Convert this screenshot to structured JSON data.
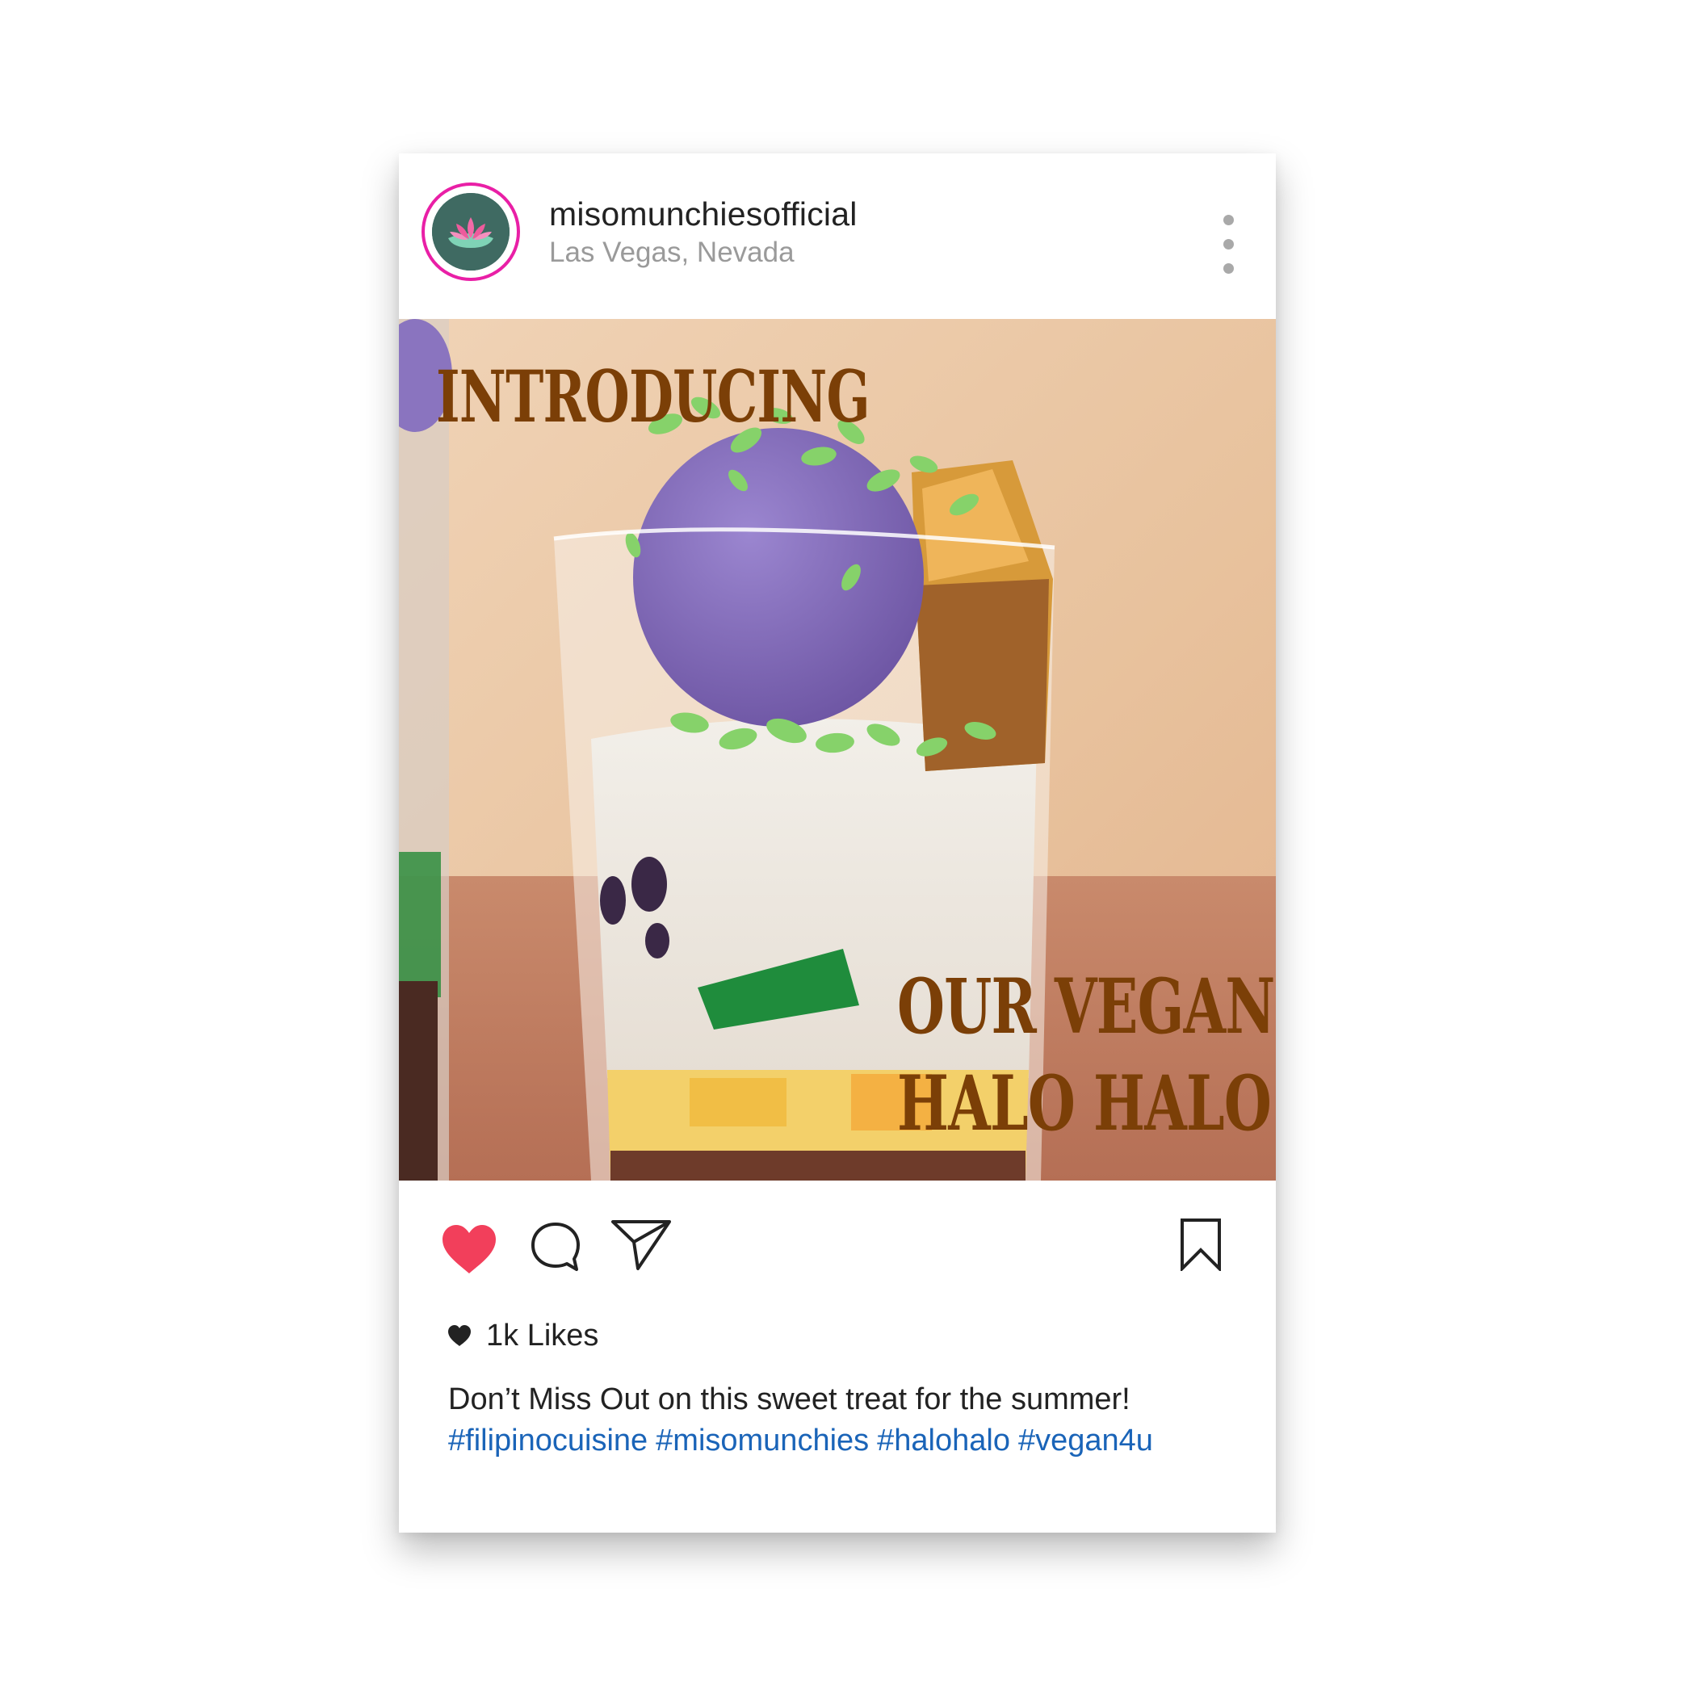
{
  "post": {
    "username": "misomunchiesofficial",
    "location": "Las Vegas, Nevada",
    "image": {
      "line1": "INTRODUCING",
      "line2": "OUR VEGAN",
      "line3": "HALO HALO"
    },
    "likes": "1k Likes",
    "caption": "Don’t Miss Out on this sweet treat for the summer!",
    "hashtags": [
      "#filipinocuisine",
      "#misomunchies",
      "#halohalo",
      "#vegan4u"
    ]
  },
  "colors": {
    "ring": "#e91fa6",
    "avatar_bg": "#3f6a62",
    "heart": "#f23f5b",
    "headline": "#7b3f07",
    "hashtag": "#1a64b8"
  },
  "icons": [
    "lotus-logo-icon",
    "more-options-icon",
    "heart-icon",
    "comment-icon",
    "share-icon",
    "bookmark-icon",
    "small-heart-icon"
  ]
}
